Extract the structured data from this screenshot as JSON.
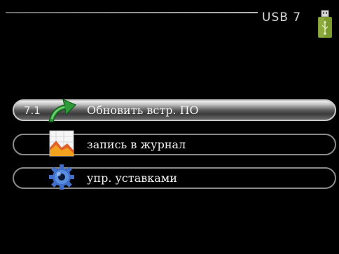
{
  "header": {
    "title": "USB  7"
  },
  "menu": {
    "items": [
      {
        "number": "7.1",
        "label": "Обновить встр. ПО",
        "icon": "update-arrow-icon",
        "selected": true
      },
      {
        "number": "",
        "label": "запись в журнал",
        "icon": "log-chart-icon",
        "selected": false
      },
      {
        "number": "",
        "label": "упр. уставками",
        "icon": "settings-gear-icon",
        "selected": false
      }
    ]
  },
  "colors": {
    "background": "#000000",
    "row_border": "#8a8a8a",
    "text": "#f2f2f2",
    "usb_green": "#6f8f2a"
  }
}
